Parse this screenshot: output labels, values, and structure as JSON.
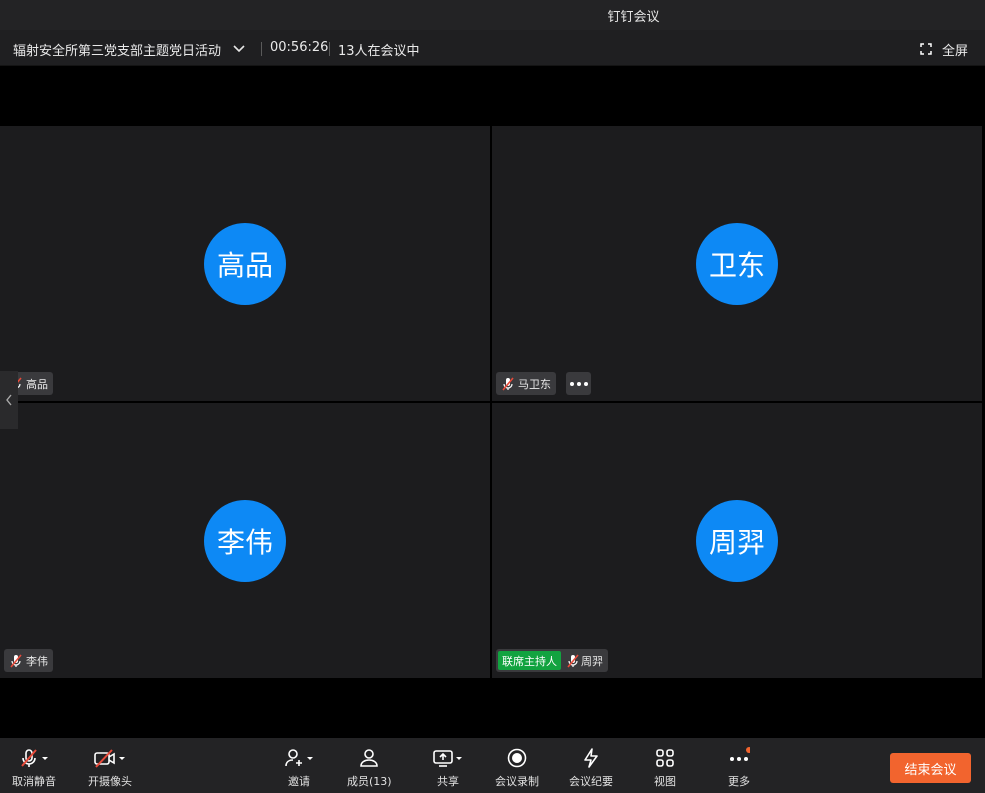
{
  "window": {
    "title": "钉钉会议"
  },
  "infobar": {
    "meeting_title": "辐射安全所第三党支部主题党日活动",
    "timer": "00:56:26",
    "participant_count": "13人在会议中",
    "fullscreen_label": "全屏"
  },
  "tiles": [
    {
      "avatar_text": "高品",
      "name": "高品"
    },
    {
      "avatar_text": "卫东",
      "name": "马卫东"
    },
    {
      "avatar_text": "李伟",
      "name": "李伟"
    },
    {
      "avatar_text": "周羿",
      "name": "周羿",
      "role_badge": "联席主持人"
    }
  ],
  "toolbar": {
    "mute_label": "取消静音",
    "camera_label": "开摄像头",
    "invite_label": "邀请",
    "members_label": "成员(13)",
    "share_label": "共享",
    "record_label": "会议录制",
    "minutes_label": "会议纪要",
    "view_label": "视图",
    "more_label": "更多",
    "end_label": "结束会议"
  },
  "colors": {
    "avatar": "#0d89f5",
    "end_button": "#f2642e",
    "host_badge": "#12a340",
    "muted_icon": "#e84a3a"
  }
}
